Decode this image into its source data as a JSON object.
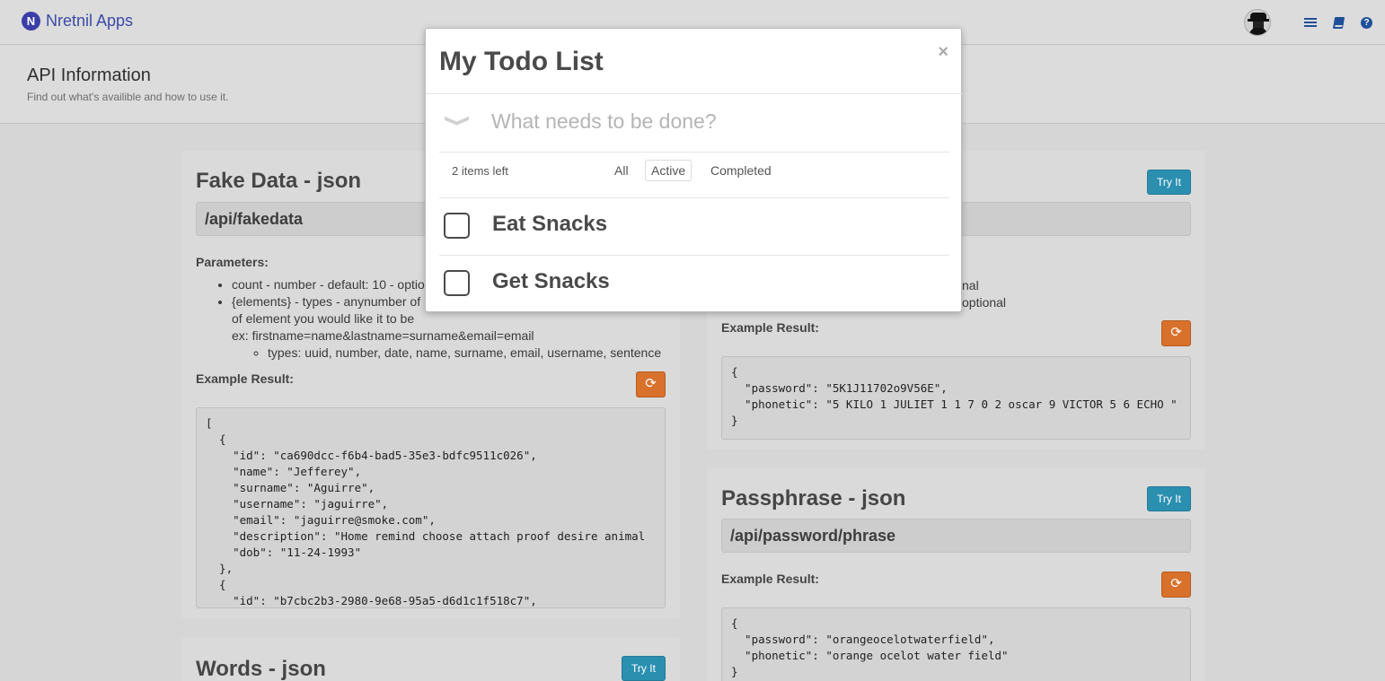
{
  "nav": {
    "brand_logo": "N",
    "brand_name": "Nretnil Apps",
    "icons": [
      "avatar",
      "list-icon",
      "book-icon",
      "help-icon"
    ]
  },
  "header": {
    "title": "API Information",
    "subtitle": "Find out what's availible and how to use it."
  },
  "fake_data": {
    "title": "Fake Data - json",
    "endpoint": "/api/fakedata",
    "params_label": "Parameters:",
    "param_count": "count - number - default: 10 - optio",
    "param_elements_1": "{elements} - types - anynumber of",
    "param_elements_2": "of element you would like it to be",
    "param_elements_3": "ex: firstname=name&lastname=surname&email=email",
    "param_types": "types: uuid, number, date, name, surname, email, username, sentence",
    "example_label": "Example Result:",
    "code": "[\n  {\n    \"id\": \"ca690dcc-f6b4-bad5-35e3-bdfc9511c026\",\n    \"name\": \"Jefferey\",\n    \"surname\": \"Aguirre\",\n    \"username\": \"jaguirre\",\n    \"email\": \"jaguirre@smoke.com\",\n    \"description\": \"Home remind choose attach proof desire animal\n    \"dob\": \"11-24-1993\"\n  },\n  {\n    \"id\": \"b7cbc2b3-2980-9e68-95a5-d6d1c1f518c7\","
  },
  "words": {
    "title": "Words - json",
    "try_label": "Try It"
  },
  "password": {
    "try_label": "Try It",
    "param_line1": "nal",
    "param_line2": "optional",
    "example_label": "Example Result:",
    "code": "{\n  \"password\": \"5K1J11702o9V56E\",\n  \"phonetic\": \"5 KILO 1 JULIET 1 1 7 0 2 oscar 9 VICTOR 5 6 ECHO \"\n}"
  },
  "passphrase": {
    "title": "Passphrase - json",
    "endpoint": "/api/password/phrase",
    "try_label": "Try It",
    "example_label": "Example Result:",
    "code": "{\n  \"password\": \"orangeocelotwaterfield\",\n  \"phonetic\": \"orange ocelot water field\"\n}"
  },
  "todo": {
    "title": "My Todo List",
    "close": "×",
    "toggle": "❯",
    "placeholder": "What needs to be done?",
    "items_left": "2 items left",
    "filters": [
      "All",
      "Active",
      "Completed"
    ],
    "selected_filter": "Active",
    "items": [
      {
        "text": "Eat Snacks",
        "completed": false
      },
      {
        "text": "Get Snacks",
        "completed": false
      }
    ]
  },
  "colors": {
    "try_button": "#2b8fb0",
    "refresh_button": "#d8712c",
    "brand": "#3b4aa6"
  }
}
